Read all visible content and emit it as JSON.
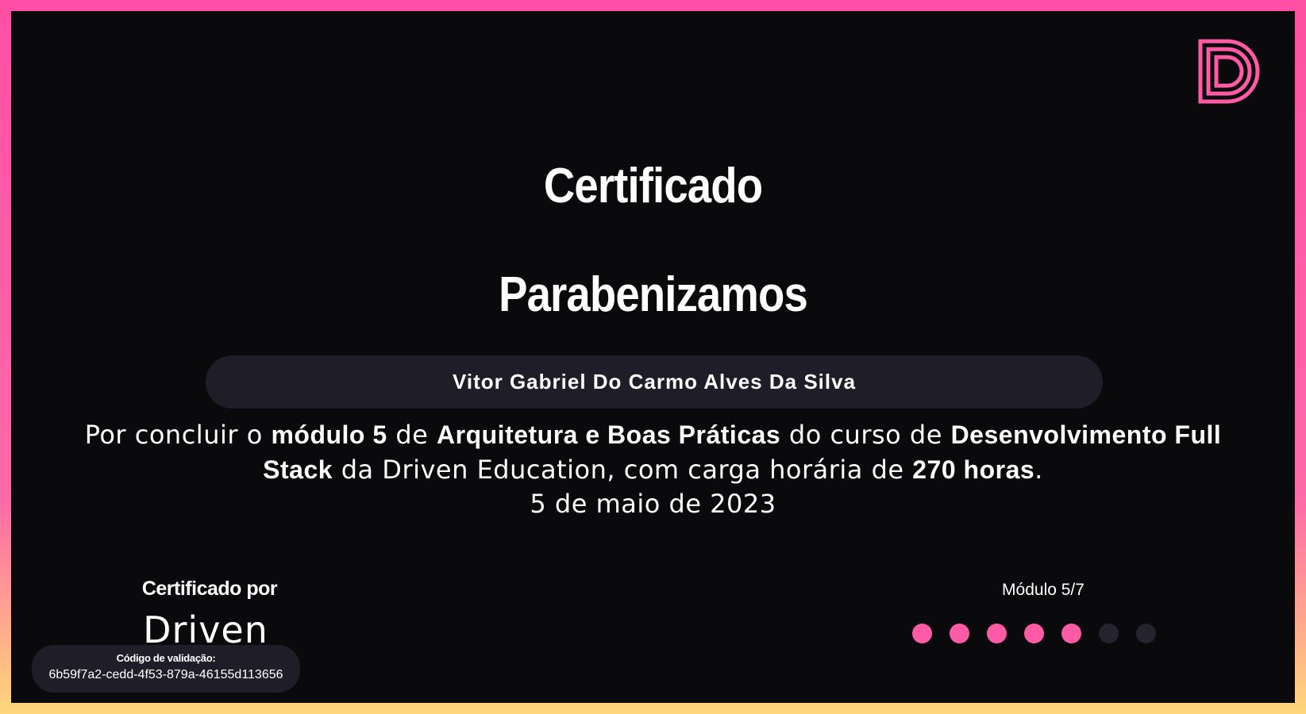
{
  "certificate": {
    "title": "Certificado",
    "congrats": "Parabenizamos",
    "student_name": "Vitor Gabriel Do Carmo Alves Da Silva",
    "description": {
      "p1": "Por concluir o ",
      "module": "módulo 5",
      "p2": " de ",
      "module_name": "Arquitetura e Boas Práticas",
      "p3": " do curso de ",
      "course": "Desenvolvimento Full Stack",
      "p4": " da Driven Education, com carga horária de ",
      "hours": "270 horas",
      "p5": "."
    },
    "date": "5 de maio de 2023",
    "certified_by_label": "Certificado por",
    "brand_wordmark": "Driven",
    "validation_label": "Código de validação:",
    "validation_code": "6b59f7a2-cedd-4f53-879a-46155d113656",
    "module_progress_label": "Módulo 5/7",
    "modules_completed": 5,
    "modules_total": 7
  },
  "colors": {
    "accent": "#ff5aa6",
    "background": "#0a090b",
    "pill": "#1f1e28",
    "inactive_dot": "#24232e",
    "border_gradient_top": "#ff4fa6",
    "border_gradient_bottom": "#ffd77a"
  },
  "icons": {
    "logo": "driven-d-logo-icon"
  }
}
